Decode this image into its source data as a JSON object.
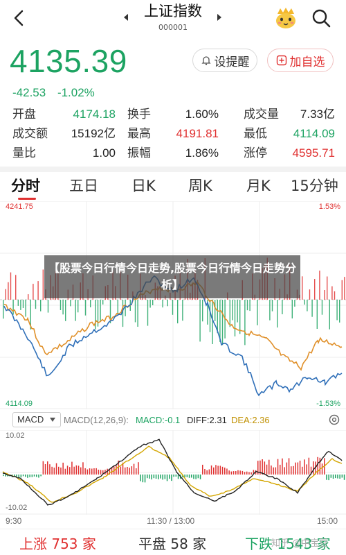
{
  "header": {
    "title": "上证指数",
    "code": "000001"
  },
  "quote": {
    "price": "4135.39",
    "change": "-42.53",
    "change_pct": "-1.02%",
    "remind_label": "设提醒",
    "favorite_label": "加自选"
  },
  "stats": [
    [
      {
        "label": "开盘",
        "value": "4174.18",
        "color": "#1da362"
      },
      {
        "label": "换手",
        "value": "1.60%",
        "color": "#222222"
      },
      {
        "label": "成交量",
        "value": "7.33亿",
        "color": "#222222"
      }
    ],
    [
      {
        "label": "成交额",
        "value": "15192亿",
        "color": "#222222"
      },
      {
        "label": "最高",
        "value": "4191.81",
        "color": "#e03030"
      },
      {
        "label": "最低",
        "value": "4114.09",
        "color": "#1da362"
      }
    ],
    [
      {
        "label": "量比",
        "value": "1.00",
        "color": "#222222"
      },
      {
        "label": "振幅",
        "value": "1.86%",
        "color": "#222222"
      },
      {
        "label": "涨停",
        "value": "4595.71",
        "color": "#e03030"
      }
    ]
  ],
  "tabs": [
    "分时",
    "五日",
    "日K",
    "周K",
    "月K",
    "15分钟"
  ],
  "chart": {
    "high_label": "4241.75",
    "low_label": "4114.09",
    "high_pct": "1.53%",
    "low_pct": "-1.53%",
    "overlay_text": "【股票今日行情今日走势,股票今日行情今日走势分析】"
  },
  "macd": {
    "selector": "MACD",
    "params": "MACD(12,26,9):",
    "macd_value": "MACD:-0.1",
    "diff_value": "DIFF:2.31",
    "dea_value": "DEA:2.36",
    "top_label": "10.02",
    "bottom_label": "-10.02"
  },
  "time_axis": [
    "9:30",
    "11:30 / 13:00",
    "15:00"
  ],
  "market_breadth": {
    "up_label": "上涨",
    "up_count": "753",
    "up_unit": "家",
    "flat_label": "平盘",
    "flat_count": "58",
    "flat_unit": "家",
    "down_label": "下跌",
    "down_count": "1543",
    "down_unit": "家"
  },
  "watermark": "知乎 @中宝豆",
  "colors": {
    "up": "#e03030",
    "down": "#1da362",
    "price_line": "#2f6fb8",
    "avg_line": "#e0902a"
  }
}
